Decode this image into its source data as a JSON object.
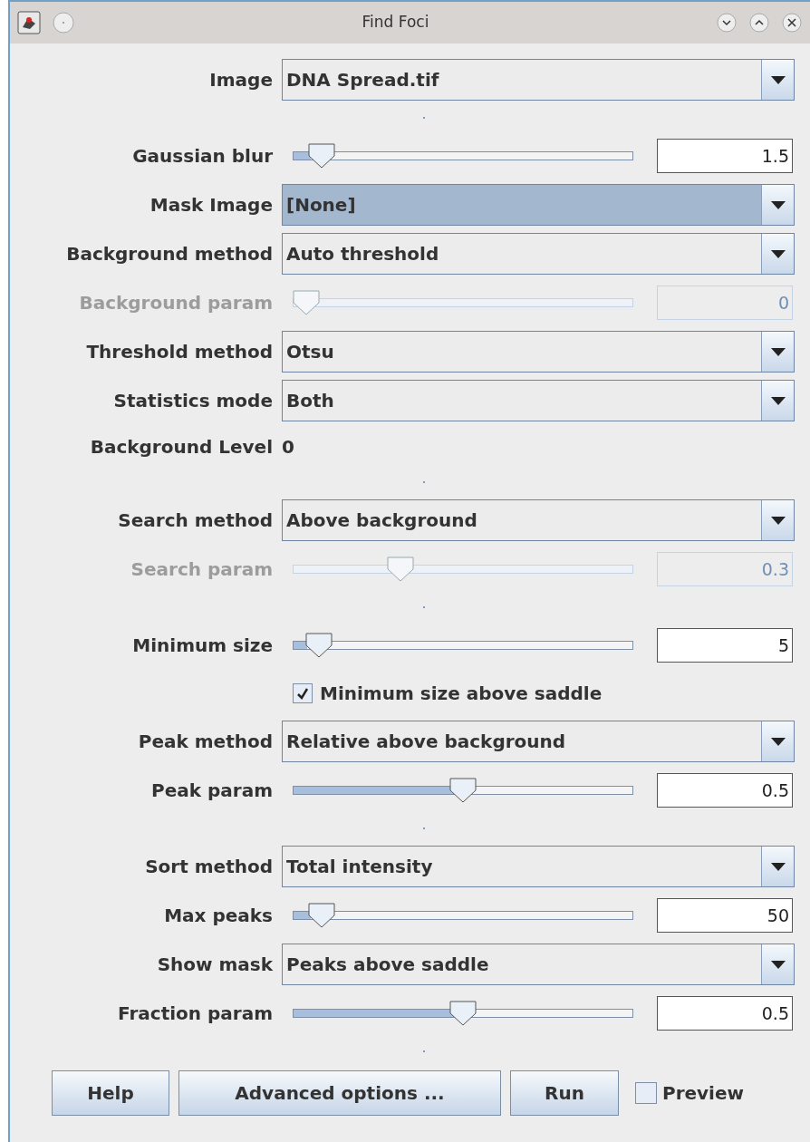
{
  "window": {
    "title": "Find Foci"
  },
  "rows": [
    {
      "kind": "dropdown",
      "label": "Image",
      "value": "DNA Spread.tif",
      "highlighted": false,
      "disabled": false
    },
    {
      "kind": "separator"
    },
    {
      "kind": "slider",
      "label": "Gaussian blur",
      "level": 0.05,
      "value": "1.5",
      "disabled": false
    },
    {
      "kind": "dropdown",
      "label": "Mask Image",
      "value": "[None]",
      "highlighted": true,
      "disabled": false
    },
    {
      "kind": "dropdown",
      "label": "Background method",
      "value": "Auto threshold",
      "highlighted": false,
      "disabled": false
    },
    {
      "kind": "slider",
      "label": "Background param",
      "level": 0,
      "value": "0",
      "disabled": true
    },
    {
      "kind": "dropdown",
      "label": "Threshold method",
      "value": "Otsu",
      "highlighted": false,
      "disabled": false
    },
    {
      "kind": "dropdown",
      "label": "Statistics mode",
      "value": "Both",
      "highlighted": false,
      "disabled": false
    },
    {
      "kind": "info",
      "label": "Background Level",
      "value": "0"
    },
    {
      "kind": "separator"
    },
    {
      "kind": "dropdown",
      "label": "Search method",
      "value": "Above background",
      "highlighted": false,
      "disabled": false
    },
    {
      "kind": "slider",
      "label": "Search param",
      "level": 0.3,
      "value": "0.3",
      "disabled": true
    },
    {
      "kind": "separator"
    },
    {
      "kind": "slider",
      "label": "Minimum size",
      "level": 0.04,
      "value": "5",
      "disabled": false
    },
    {
      "kind": "checkbox",
      "label": "Minimum size above saddle",
      "checked": true
    },
    {
      "kind": "dropdown",
      "label": "Peak method",
      "value": "Relative above background",
      "highlighted": false,
      "disabled": false
    },
    {
      "kind": "slider",
      "label": "Peak param",
      "level": 0.5,
      "value": "0.5",
      "disabled": false
    },
    {
      "kind": "separator"
    },
    {
      "kind": "dropdown",
      "label": "Sort method",
      "value": "Total intensity",
      "highlighted": false,
      "disabled": false
    },
    {
      "kind": "slider",
      "label": "Max peaks",
      "level": 0.05,
      "value": "50",
      "disabled": false
    },
    {
      "kind": "dropdown",
      "label": "Show mask",
      "value": "Peaks above saddle",
      "highlighted": false,
      "disabled": false
    },
    {
      "kind": "slider",
      "label": "Fraction param",
      "level": 0.5,
      "value": "0.5",
      "disabled": false
    },
    {
      "kind": "separator"
    }
  ],
  "buttons": [
    "Help",
    "Advanced options ...",
    "Run"
  ],
  "preview": {
    "label": "Preview",
    "checked": false
  }
}
